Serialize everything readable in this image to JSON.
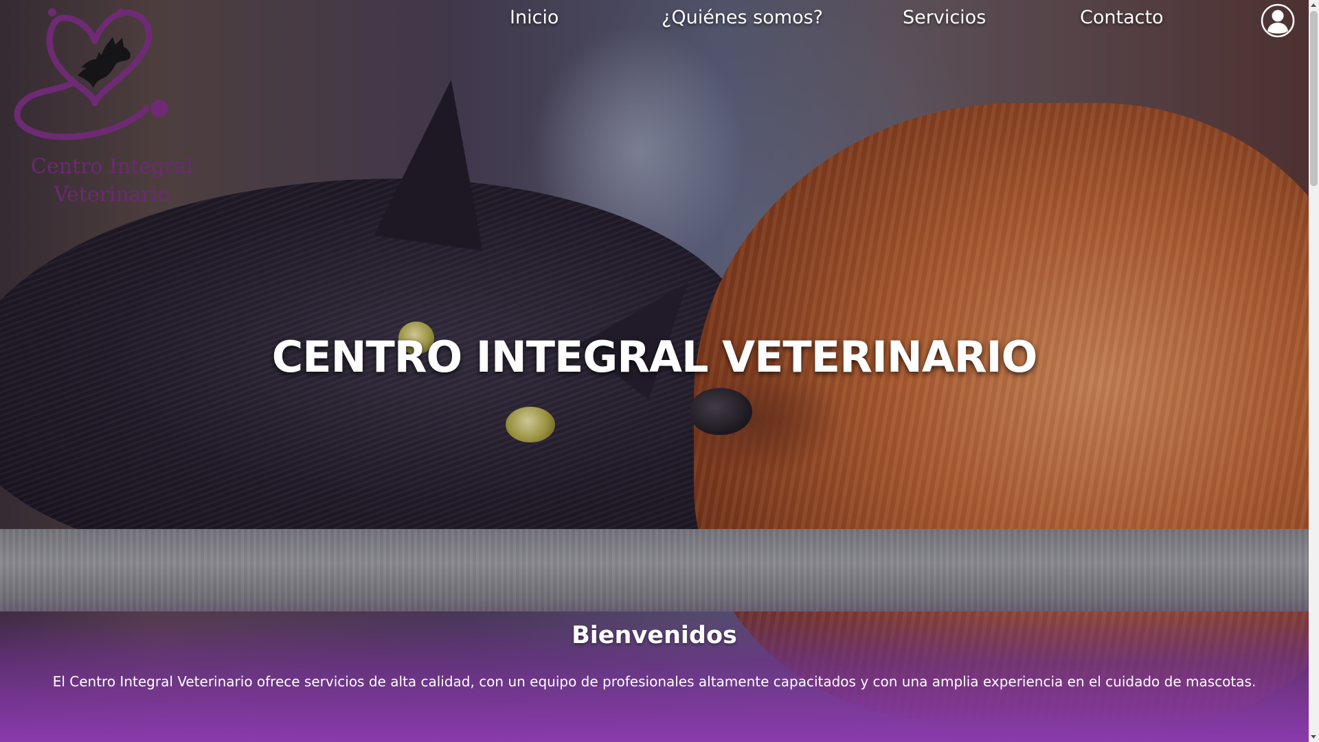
{
  "logo": {
    "icon": "heart-stethoscope-cat-dog-logo",
    "line1": "Centro Integral",
    "line2": "Veterinario",
    "color": "#6a2a72"
  },
  "nav": {
    "items": [
      {
        "label": "Inicio"
      },
      {
        "label": "¿Quiénes somos?"
      },
      {
        "label": "Servicios"
      },
      {
        "label": "Contacto"
      }
    ],
    "user_icon": "user-account-icon"
  },
  "hero": {
    "title": "CENTRO INTEGRAL VETERINARIO"
  },
  "welcome": {
    "heading": "Bienvenidos",
    "text": "El Centro Integral Veterinario ofrece servicios de alta calidad, con un equipo de profesionales altamente capacitados y con una amplia experiencia en el cuidado de mascotas."
  },
  "colors": {
    "accent_purple": "#8a3aac",
    "logo_purple": "#6a2a72",
    "text": "#ffffff"
  }
}
